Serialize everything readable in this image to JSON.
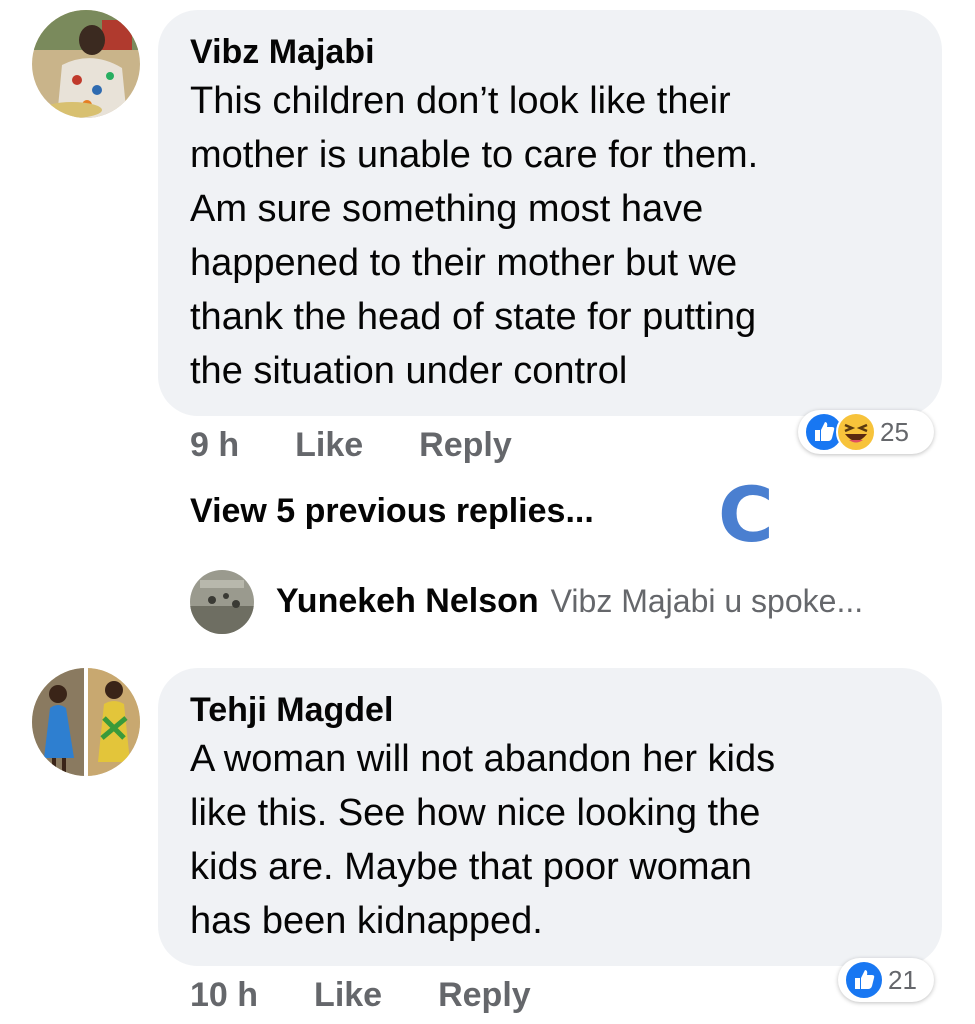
{
  "comments": [
    {
      "author": "Vibz Majabi",
      "lines": [
        "This children don’t look like their",
        "mother is unable to care for them.",
        "Am sure something most have",
        "happened to their mother but we",
        "thank the head of state for putting",
        "the situation under control"
      ],
      "time": "9 h",
      "like_label": "Like",
      "reply_label": "Reply",
      "reaction_icons": [
        "like-icon",
        "haha-icon"
      ],
      "reaction_count": "25"
    },
    {
      "author": "Tehji Magdel",
      "lines": [
        "A woman will not abandon her kids",
        "like this. See how nice looking the",
        "kids are. Maybe that poor woman",
        "has been kidnapped."
      ],
      "time": "10 h",
      "like_label": "Like",
      "reply_label": "Reply",
      "reaction_icons": [
        "like-icon"
      ],
      "reaction_count": "21"
    }
  ],
  "view_previous_label": "View 5 previous replies...",
  "loading_glyph": "C",
  "reply_preview": {
    "author": "Yunekeh Nelson",
    "text": "Vibz Majabi u spoke..."
  },
  "colors": {
    "bubble": "#f0f2f5",
    "secondary_text": "#65676b",
    "like_blue": "#1877f2",
    "haha_yellow": "#f7c33b"
  }
}
